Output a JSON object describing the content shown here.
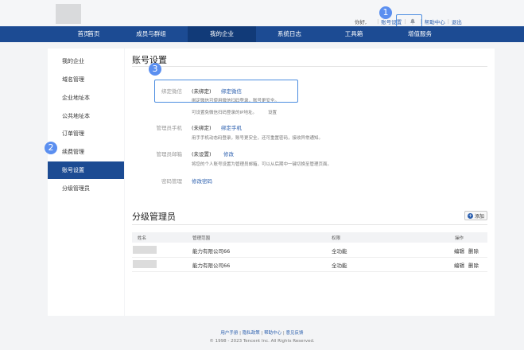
{
  "header": {
    "greeting": "你好,",
    "links": [
      "账号设置",
      "帮助中心",
      "退出"
    ]
  },
  "annotations": [
    "1",
    "2",
    "3"
  ],
  "nav": {
    "items": [
      "首页",
      "成员与群组",
      "我的企业",
      "系统日志",
      "工具箱",
      "增值服务"
    ],
    "active": "我的企业"
  },
  "sidebar": {
    "items": [
      "我的企业",
      "域名管理",
      "企业地址本",
      "公共地址本",
      "订单管理",
      "续费管理",
      "账号设置",
      "分级管理员"
    ],
    "active": "账号设置"
  },
  "account": {
    "title": "账号设置",
    "wechat": {
      "label": "绑定微信",
      "status": "(未绑定)",
      "action": "绑定微信",
      "hint1": "绑定微信可使用微信扫码登录，账号更安全。",
      "hint2": "可设置免微信扫码登录的IP地址。",
      "hint2_link": "设置"
    },
    "phone": {
      "label": "管理员手机",
      "status": "(未绑定)",
      "action": "绑定手机",
      "hint": "用手手机动态码登录，账号更安全，还可重置密码，接收异常通知。"
    },
    "email": {
      "label": "管理员邮箱",
      "status": "(未设置)",
      "action": "修改",
      "hint": "将您的个人账号设置为管理员邮箱，可以从后期中一键切换至管理页面。"
    },
    "password": {
      "label": "密码管理",
      "action": "修改密码"
    }
  },
  "sub_admins": {
    "title": "分级管理员",
    "add_label": "添加",
    "add_icon": "plus-icon",
    "columns": [
      "姓名",
      "管理范围",
      "权限",
      "操作"
    ],
    "rows": [
      {
        "scope": "能力有限公司66",
        "permission": "全功能",
        "edit": "编辑",
        "delete": "删除"
      },
      {
        "scope": "能力有限公司66",
        "permission": "全功能",
        "edit": "编辑",
        "delete": "删除"
      }
    ]
  },
  "footer": {
    "links": [
      "用户手册",
      "隐私政策",
      "帮助中心",
      "意见反馈"
    ],
    "copyright": "© 1998 - 2023 Tencent Inc. All Rights Reserved."
  },
  "colors": {
    "nav_bg": "#1c4b93",
    "nav_active": "#113a78",
    "link": "#2b5fae",
    "highlight": "#4c8de0",
    "badge": "#5b8ff0"
  }
}
